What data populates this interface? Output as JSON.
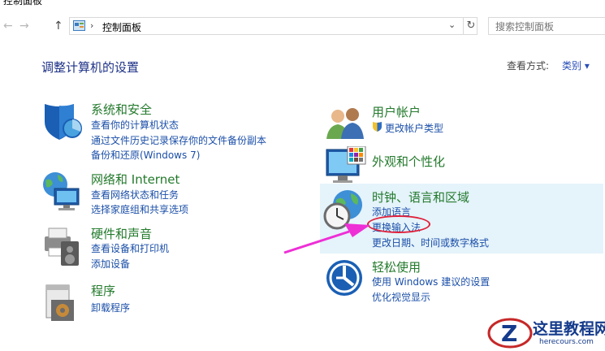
{
  "window": {
    "title": "控制面板"
  },
  "address_bar": {
    "back_label": "←",
    "forward_label": "→",
    "up_label": "↑",
    "crumb_separator": "›",
    "crumb": "控制面板",
    "dropdown_label": "⌄",
    "refresh_label": "↻"
  },
  "search": {
    "placeholder": "搜索控制面板"
  },
  "main": {
    "title": "调整计算机的设置",
    "view_by_label": "查看方式:",
    "view_by_value": "类别 ▾"
  },
  "categories": {
    "system": {
      "title": "系统和安全",
      "links": [
        "查看你的计算机状态",
        "通过文件历史记录保存你的文件备份副本",
        "备份和还原(Windows 7)"
      ]
    },
    "network": {
      "title": "网络和 Internet",
      "links": [
        "查看网络状态和任务",
        "选择家庭组和共享选项"
      ]
    },
    "hardware": {
      "title": "硬件和声音",
      "links": [
        "查看设备和打印机",
        "添加设备"
      ]
    },
    "programs": {
      "title": "程序",
      "links": [
        "卸载程序"
      ]
    },
    "users": {
      "title": "用户帐户",
      "links": [
        "更改帐户类型"
      ]
    },
    "appearance": {
      "title": "外观和个性化",
      "links": []
    },
    "clock": {
      "title": "时钟、语言和区域",
      "links": [
        "添加语言",
        "更换输入法",
        "更改日期、时间或数字格式"
      ]
    },
    "ease": {
      "title": "轻松使用",
      "links": [
        "使用 Windows 建议的设置",
        "优化视觉显示"
      ]
    }
  },
  "watermark": {
    "text": "这里教程网",
    "url": "herecours.com"
  },
  "colors": {
    "category_title": "#237a2c",
    "link": "#1b4fa8",
    "page_title": "#1e3287",
    "highlight": "#e5f3fb",
    "annotation_red": "#e0203a",
    "annotation_arrow": "#ee2fd6"
  }
}
